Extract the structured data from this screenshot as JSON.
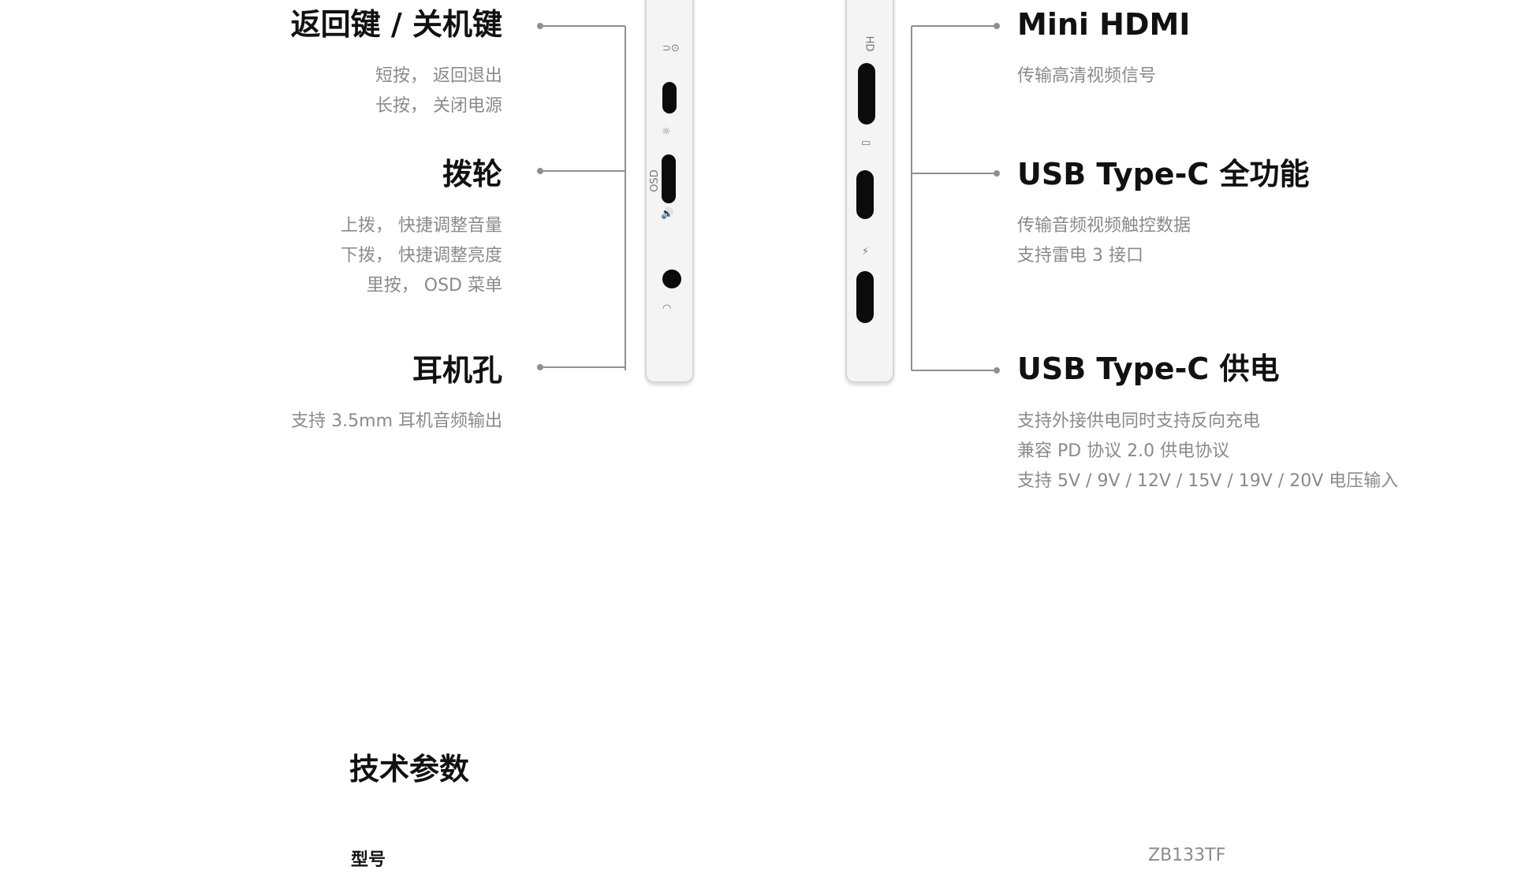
{
  "left_features": [
    {
      "title": "返回键 / 关机键",
      "lines": [
        "短按，  返回退出",
        "长按，  关闭电源"
      ]
    },
    {
      "title": "拨轮",
      "lines": [
        "上拨，  快捷调整音量",
        "下拨，  快捷调整亮度",
        "里按，  OSD 菜单"
      ]
    },
    {
      "title": "耳机孔",
      "lines": [
        "支持 3.5mm 耳机音频输出"
      ]
    }
  ],
  "right_features": [
    {
      "title": "Mini HDMI",
      "lines": [
        "传输高清视频信号"
      ]
    },
    {
      "title": "USB Type-C 全功能",
      "lines": [
        "传输音频视频触控数据",
        "支持雷电 3 接口"
      ]
    },
    {
      "title": "USB Type-C 供电",
      "lines": [
        "支持外接供电同时支持反向充电",
        "兼容 PD 协议 2.0 供电协议",
        "支持 5V / 9V / 12V / 15V / 19V / 20V 电压输入"
      ]
    }
  ],
  "device_left": {
    "osd_mark": "OSD",
    "side_marks": "⊃/⊙ · ☼ · +/- · 🔊"
  },
  "device_right": {
    "hd_mark": "HD",
    "bolt_mark": "⚡"
  },
  "specs": {
    "title": "技术参数",
    "rows": [
      {
        "label": "型号",
        "value": "ZB133TF"
      }
    ]
  },
  "colors": {
    "line": "#8f8f8f",
    "device_body": "#f4f4f4",
    "port": "#0b0b0b",
    "desc_text": "#8a8a8a"
  }
}
